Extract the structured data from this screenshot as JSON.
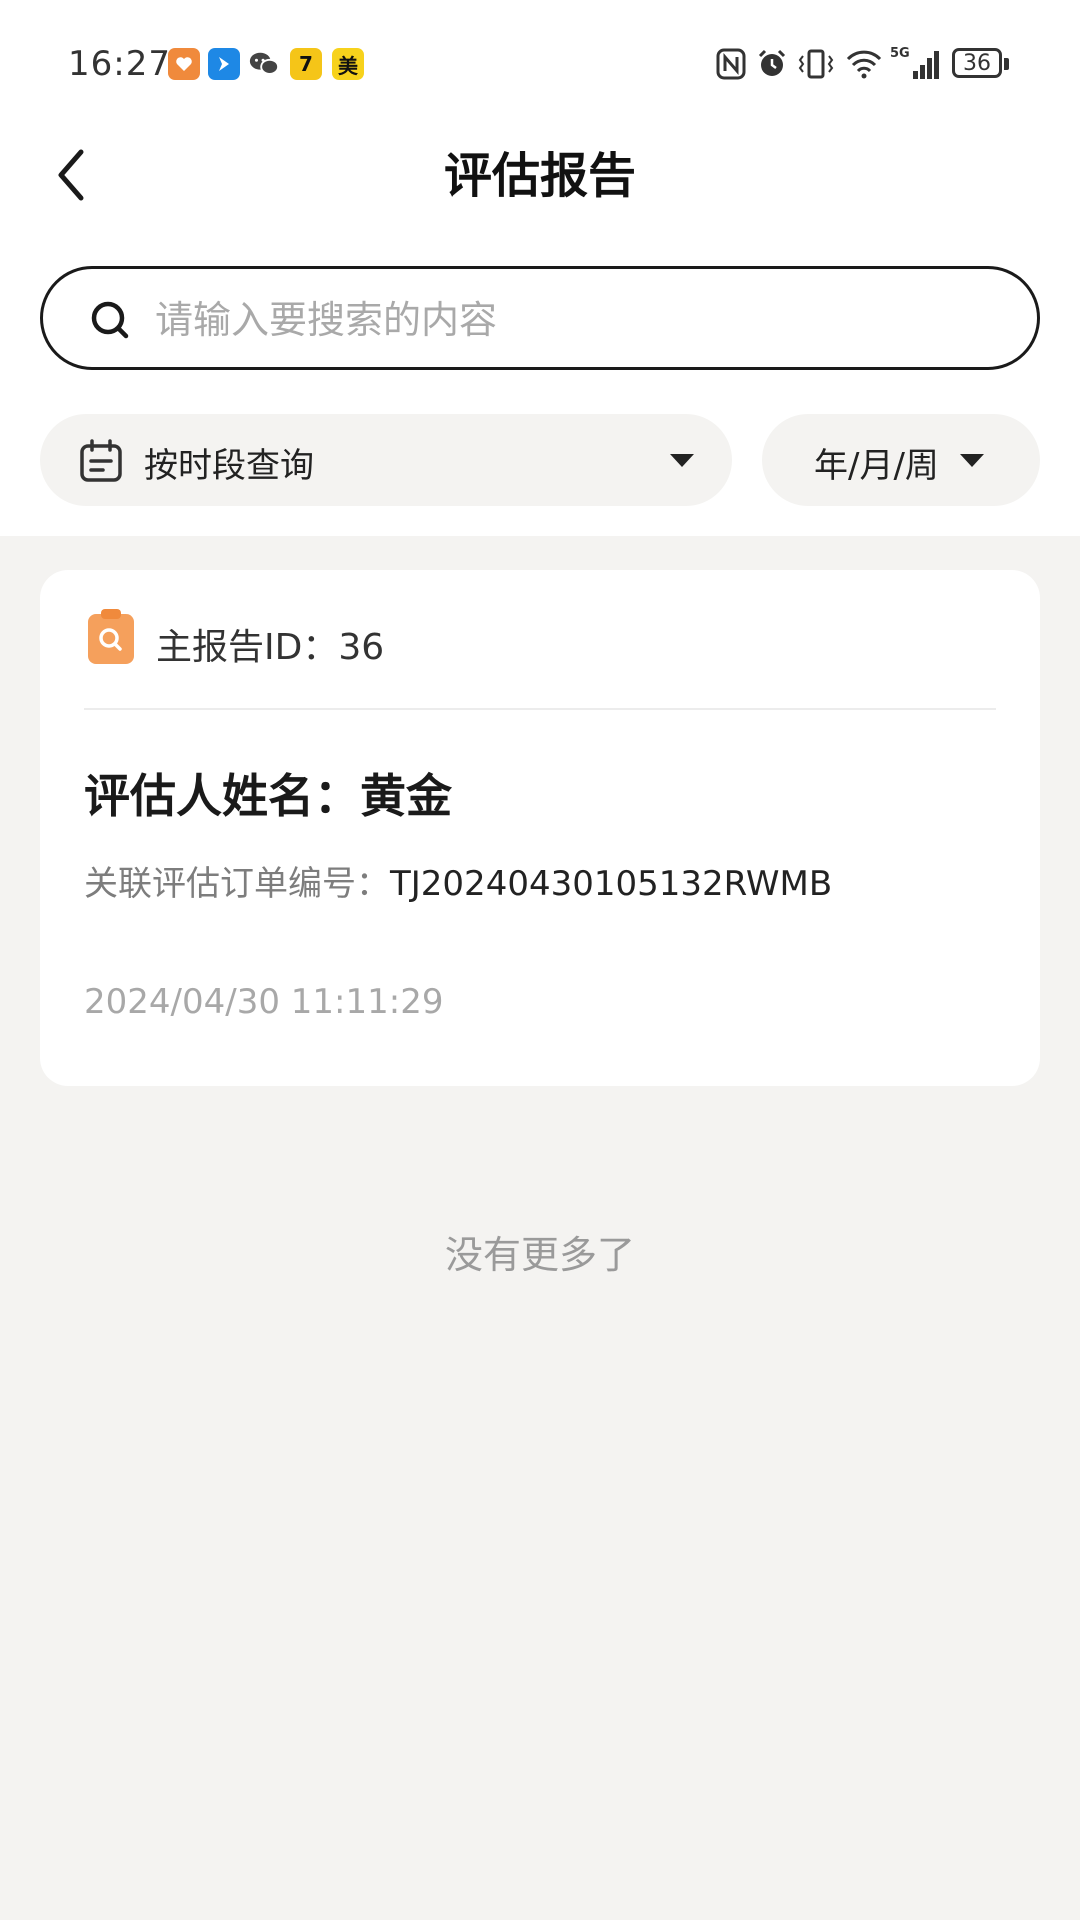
{
  "status_bar": {
    "time": "16:27",
    "notification_icons": [
      "shield-badge-icon",
      "arrow-app-icon",
      "wechat-icon",
      "seven-app-icon",
      "meituan-icon"
    ],
    "meituan_glyph": "美",
    "seven_glyph": "7",
    "system_icons": [
      "nfc-icon",
      "alarm-icon",
      "vibrate-icon",
      "wifi-icon",
      "signal-5g-icon"
    ],
    "network_label": "5G",
    "battery": "36"
  },
  "header": {
    "title": "评估报告",
    "back_icon": "chevron-left-icon"
  },
  "search": {
    "placeholder": "请输入要搜索的内容",
    "value": ""
  },
  "filters": {
    "date_range_label": "按时段查询",
    "period_label": "年/月/周"
  },
  "reports": [
    {
      "id_label": "主报告ID：36",
      "assessor": "评估人姓名：黄金",
      "order_label": "关联评估订单编号：",
      "order_number": "TJ20240430105132RWMB",
      "timestamp": "2024/04/30 11:11:29"
    }
  ],
  "list_footer": "没有更多了",
  "colors": {
    "accent_orange": "#F5A05C",
    "page_background": "#F4F3F1",
    "card_background": "#FFFFFF"
  }
}
